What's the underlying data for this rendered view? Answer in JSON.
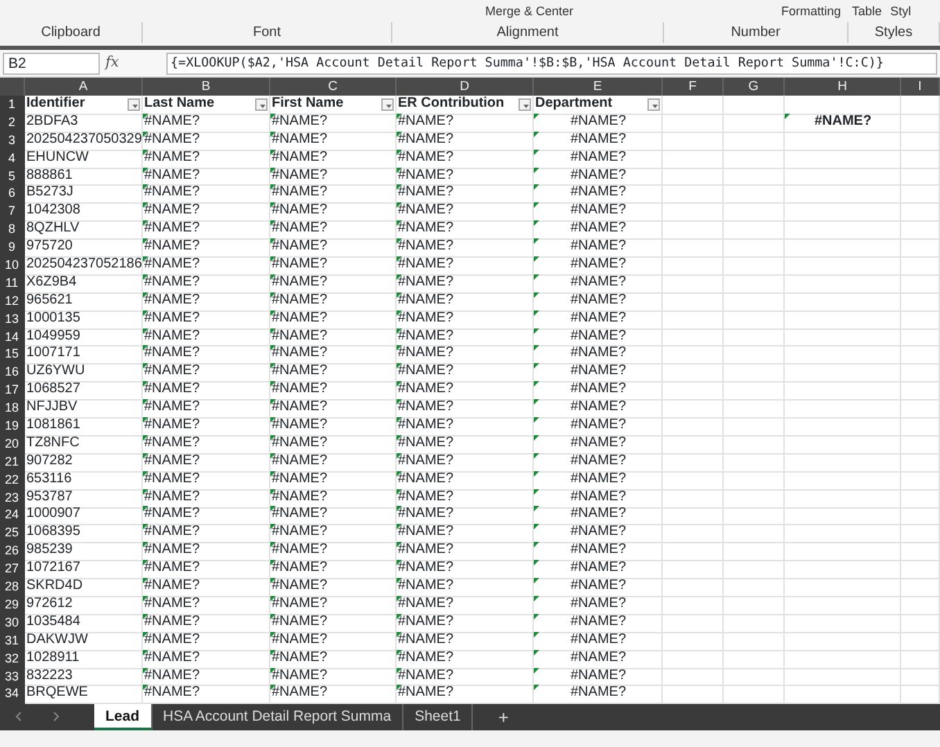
{
  "ribbon": {
    "top_items": [
      "Merge & Center",
      "Formatting",
      "Table",
      "Styl"
    ],
    "groups": [
      "Clipboard",
      "Font",
      "Alignment",
      "Number",
      "Styles"
    ]
  },
  "formula_bar": {
    "name_box": "B2",
    "fx": "fx",
    "formula": "{=XLOOKUP($A2,'HSA Account Detail Report Summa'!$B:$B,'HSA Account Detail Report Summa'!C:C)}"
  },
  "columns": [
    "A",
    "B",
    "C",
    "D",
    "E",
    "F",
    "G",
    "H",
    "I"
  ],
  "header_row": {
    "row_number": "1",
    "cells": [
      "Identifier",
      "Last Name",
      "First Name",
      "ER Contribution",
      "Department"
    ]
  },
  "rows": [
    {
      "row_number": "2",
      "cells": [
        "2BDFA3",
        "#NAME?",
        "#NAME?",
        "#NAME?",
        "#NAME?"
      ],
      "extra": "#NAME?"
    },
    {
      "row_number": "3",
      "cells": [
        "202504237050329",
        "#NAME?",
        "#NAME?",
        "#NAME?",
        "#NAME?"
      ]
    },
    {
      "row_number": "4",
      "cells": [
        "EHUNCW",
        "#NAME?",
        "#NAME?",
        "#NAME?",
        "#NAME?"
      ]
    },
    {
      "row_number": "5",
      "cells": [
        "888861",
        "#NAME?",
        "#NAME?",
        "#NAME?",
        "#NAME?"
      ]
    },
    {
      "row_number": "6",
      "cells": [
        "B5273J",
        "#NAME?",
        "#NAME?",
        "#NAME?",
        "#NAME?"
      ]
    },
    {
      "row_number": "7",
      "cells": [
        "1042308",
        "#NAME?",
        "#NAME?",
        "#NAME?",
        "#NAME?"
      ]
    },
    {
      "row_number": "8",
      "cells": [
        "8QZHLV",
        "#NAME?",
        "#NAME?",
        "#NAME?",
        "#NAME?"
      ]
    },
    {
      "row_number": "9",
      "cells": [
        "975720",
        "#NAME?",
        "#NAME?",
        "#NAME?",
        "#NAME?"
      ]
    },
    {
      "row_number": "10",
      "cells": [
        "202504237052186",
        "#NAME?",
        "#NAME?",
        "#NAME?",
        "#NAME?"
      ]
    },
    {
      "row_number": "11",
      "cells": [
        "X6Z9B4",
        "#NAME?",
        "#NAME?",
        "#NAME?",
        "#NAME?"
      ]
    },
    {
      "row_number": "12",
      "cells": [
        "965621",
        "#NAME?",
        "#NAME?",
        "#NAME?",
        "#NAME?"
      ]
    },
    {
      "row_number": "13",
      "cells": [
        "1000135",
        "#NAME?",
        "#NAME?",
        "#NAME?",
        "#NAME?"
      ]
    },
    {
      "row_number": "14",
      "cells": [
        "1049959",
        "#NAME?",
        "#NAME?",
        "#NAME?",
        "#NAME?"
      ]
    },
    {
      "row_number": "15",
      "cells": [
        "1007171",
        "#NAME?",
        "#NAME?",
        "#NAME?",
        "#NAME?"
      ]
    },
    {
      "row_number": "16",
      "cells": [
        "UZ6YWU",
        "#NAME?",
        "#NAME?",
        "#NAME?",
        "#NAME?"
      ]
    },
    {
      "row_number": "17",
      "cells": [
        "1068527",
        "#NAME?",
        "#NAME?",
        "#NAME?",
        "#NAME?"
      ]
    },
    {
      "row_number": "18",
      "cells": [
        "NFJJBV",
        "#NAME?",
        "#NAME?",
        "#NAME?",
        "#NAME?"
      ]
    },
    {
      "row_number": "19",
      "cells": [
        "1081861",
        "#NAME?",
        "#NAME?",
        "#NAME?",
        "#NAME?"
      ]
    },
    {
      "row_number": "20",
      "cells": [
        "TZ8NFC",
        "#NAME?",
        "#NAME?",
        "#NAME?",
        "#NAME?"
      ]
    },
    {
      "row_number": "21",
      "cells": [
        "907282",
        "#NAME?",
        "#NAME?",
        "#NAME?",
        "#NAME?"
      ]
    },
    {
      "row_number": "22",
      "cells": [
        "653116",
        "#NAME?",
        "#NAME?",
        "#NAME?",
        "#NAME?"
      ]
    },
    {
      "row_number": "23",
      "cells": [
        "953787",
        "#NAME?",
        "#NAME?",
        "#NAME?",
        "#NAME?"
      ]
    },
    {
      "row_number": "24",
      "cells": [
        "1000907",
        "#NAME?",
        "#NAME?",
        "#NAME?",
        "#NAME?"
      ]
    },
    {
      "row_number": "25",
      "cells": [
        "1068395",
        "#NAME?",
        "#NAME?",
        "#NAME?",
        "#NAME?"
      ]
    },
    {
      "row_number": "26",
      "cells": [
        "985239",
        "#NAME?",
        "#NAME?",
        "#NAME?",
        "#NAME?"
      ]
    },
    {
      "row_number": "27",
      "cells": [
        "1072167",
        "#NAME?",
        "#NAME?",
        "#NAME?",
        "#NAME?"
      ]
    },
    {
      "row_number": "28",
      "cells": [
        "SKRD4D",
        "#NAME?",
        "#NAME?",
        "#NAME?",
        "#NAME?"
      ]
    },
    {
      "row_number": "29",
      "cells": [
        "972612",
        "#NAME?",
        "#NAME?",
        "#NAME?",
        "#NAME?"
      ]
    },
    {
      "row_number": "30",
      "cells": [
        "1035484",
        "#NAME?",
        "#NAME?",
        "#NAME?",
        "#NAME?"
      ]
    },
    {
      "row_number": "31",
      "cells": [
        "DAKWJW",
        "#NAME?",
        "#NAME?",
        "#NAME?",
        "#NAME?"
      ]
    },
    {
      "row_number": "32",
      "cells": [
        "1028911",
        "#NAME?",
        "#NAME?",
        "#NAME?",
        "#NAME?"
      ]
    },
    {
      "row_number": "33",
      "cells": [
        "832223",
        "#NAME?",
        "#NAME?",
        "#NAME?",
        "#NAME?"
      ]
    },
    {
      "row_number": "34",
      "cells": [
        "BRQEWE",
        "#NAME?",
        "#NAME?",
        "#NAME?",
        "#NAME?"
      ]
    }
  ],
  "sheet_tabs": [
    {
      "label": "Lead",
      "selected": true
    },
    {
      "label": "HSA Account Detail Report Summa",
      "selected": false
    },
    {
      "label": "Sheet1",
      "selected": false
    }
  ],
  "add_sheet": "+"
}
